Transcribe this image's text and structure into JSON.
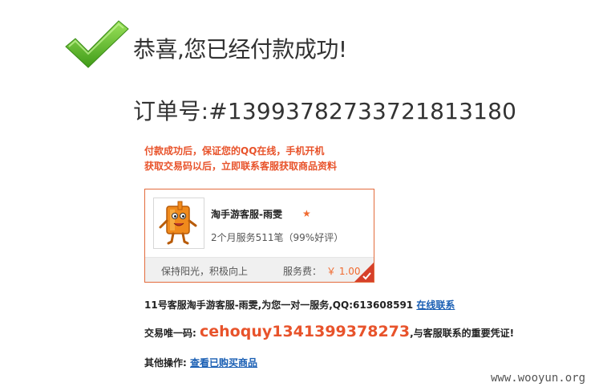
{
  "success": {
    "title": "恭喜,您已经付款成功!"
  },
  "order": {
    "label": "订单号:",
    "number": "#139937827337218131​80"
  },
  "notice": {
    "line1": "付款成功后，保证您的QQ在线，手机开机",
    "line2": "获取交易码以后，立即联系客服获取商品资料"
  },
  "service_card": {
    "name": "淘手游客服-雨雯",
    "stats": "2个月服务511笔（99%好评）",
    "motto": "保持阳光，积极向上",
    "fee_label": "服务费：",
    "fee_value": "￥ 1.00"
  },
  "info": {
    "text": "11号客服淘手游客服-雨雯,为您一对一服务,QQ:613608591",
    "online_link": "在线联系"
  },
  "code": {
    "label": "交易唯一码:",
    "value": "cehoquy1341399378273",
    "suffix": ",与客服联系的重要凭证!"
  },
  "other": {
    "label": "其他操作:",
    "link": "查看已购买商品"
  },
  "watermark": "www.wooyun.org",
  "colors": {
    "accent": "#e8532b",
    "link": "#1a5fb4",
    "check": "#5cb82a"
  }
}
